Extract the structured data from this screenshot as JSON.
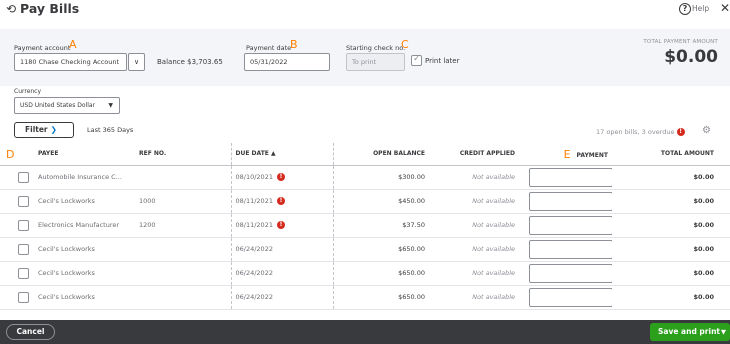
{
  "header": {
    "title": "Pay Bills",
    "help_label": "Help",
    "history_icon": "history-icon",
    "close_icon": "close-icon"
  },
  "form": {
    "payment_account": {
      "label": "Payment account",
      "annotation": "A",
      "value": "1180 Chase Checking Account",
      "balance": "Balance $3,703.65"
    },
    "payment_date": {
      "label": "Payment date",
      "annotation": "B",
      "value": "05/31/2022"
    },
    "starting_check": {
      "label": "Starting check no.",
      "annotation": "C",
      "placeholder": "To print",
      "print_later_label": "Print later",
      "print_later_checked": true
    },
    "total": {
      "label": "TOTAL PAYMENT AMOUNT",
      "value": "$0.00"
    },
    "currency": {
      "label": "Currency",
      "value": "USD United States Dollar"
    }
  },
  "filter": {
    "button_label": "Filter",
    "range": "Last 365 Days",
    "summary": "17 open bills, 3 overdue"
  },
  "table": {
    "annotations": {
      "select": "D",
      "payment": "E"
    },
    "columns": {
      "payee": "PAYEE",
      "ref": "REF NO.",
      "due": "DUE DATE ▲",
      "open": "OPEN BALANCE",
      "credit": "CREDIT APPLIED",
      "payment": "PAYMENT",
      "total": "TOTAL AMOUNT"
    },
    "rows": [
      {
        "payee": "Automobile Insurance C...",
        "ref": "",
        "due": "08/10/2021",
        "overdue": true,
        "open": "$300.00",
        "credit": "Not available",
        "total": "$0.00"
      },
      {
        "payee": "Cecil's Lockworks",
        "ref": "1000",
        "due": "08/11/2021",
        "overdue": true,
        "open": "$450.00",
        "credit": "Not available",
        "total": "$0.00"
      },
      {
        "payee": "Electronics Manufacturer",
        "ref": "1200",
        "due": "08/11/2021",
        "overdue": true,
        "open": "$37.50",
        "credit": "Not available",
        "total": "$0.00"
      },
      {
        "payee": "Cecil's Lockworks",
        "ref": "",
        "due": "06/24/2022",
        "overdue": false,
        "open": "$650.00",
        "credit": "Not available",
        "total": "$0.00"
      },
      {
        "payee": "Cecil's Lockworks",
        "ref": "",
        "due": "06/24/2022",
        "overdue": false,
        "open": "$650.00",
        "credit": "Not available",
        "total": "$0.00"
      },
      {
        "payee": "Cecil's Lockworks",
        "ref": "",
        "due": "06/24/2022",
        "overdue": false,
        "open": "$650.00",
        "credit": "Not available",
        "total": "$0.00"
      }
    ]
  },
  "footer": {
    "cancel_label": "Cancel",
    "save_label": "Save and print"
  },
  "colors": {
    "annotation": "#ff8000",
    "overdue": "#d52b1e",
    "primary": "#2ca01c",
    "footer": "#393a3d",
    "band": "#f4f5f8"
  }
}
